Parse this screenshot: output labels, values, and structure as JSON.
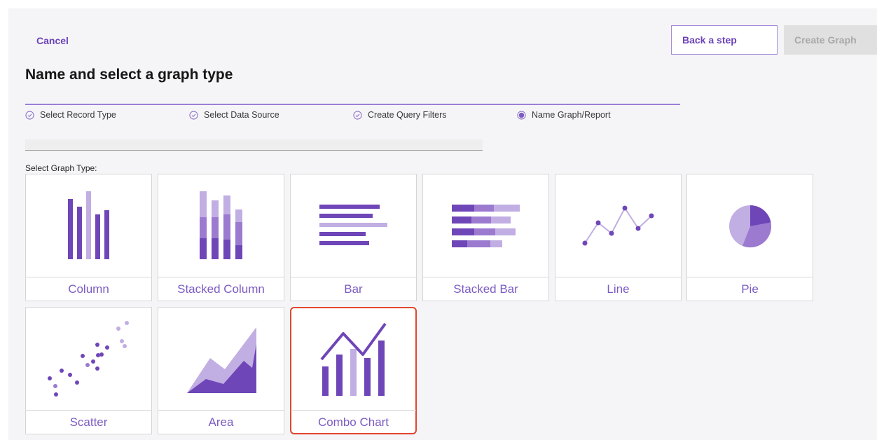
{
  "actions": {
    "cancel": "Cancel",
    "back": "Back a step",
    "create": "Create Graph"
  },
  "page_title": "Name and select a graph type",
  "steps": [
    {
      "label": "Select Record Type",
      "state": "complete"
    },
    {
      "label": "Select Data Source",
      "state": "complete"
    },
    {
      "label": "Create Query Filters",
      "state": "complete"
    },
    {
      "label": "Name Graph/Report",
      "state": "current"
    }
  ],
  "select_label": "Select Graph Type:",
  "graph_types": [
    {
      "label": "Column",
      "icon": "column-chart-icon",
      "selected": false
    },
    {
      "label": "Stacked Column",
      "icon": "stacked-column-chart-icon",
      "selected": false
    },
    {
      "label": "Bar",
      "icon": "bar-chart-icon",
      "selected": false
    },
    {
      "label": "Stacked Bar",
      "icon": "stacked-bar-chart-icon",
      "selected": false
    },
    {
      "label": "Line",
      "icon": "line-chart-icon",
      "selected": false
    },
    {
      "label": "Pie",
      "icon": "pie-chart-icon",
      "selected": false
    },
    {
      "label": "Scatter",
      "icon": "scatter-chart-icon",
      "selected": false
    },
    {
      "label": "Area",
      "icon": "area-chart-icon",
      "selected": false
    },
    {
      "label": "Combo Chart",
      "icon": "combo-chart-icon",
      "selected": true
    }
  ],
  "colors": {
    "accent": "#6b43b8",
    "dark": "#6f46b8",
    "mid": "#9b7ad0",
    "light": "#c1aee3",
    "selection_border": "#e1462f"
  }
}
